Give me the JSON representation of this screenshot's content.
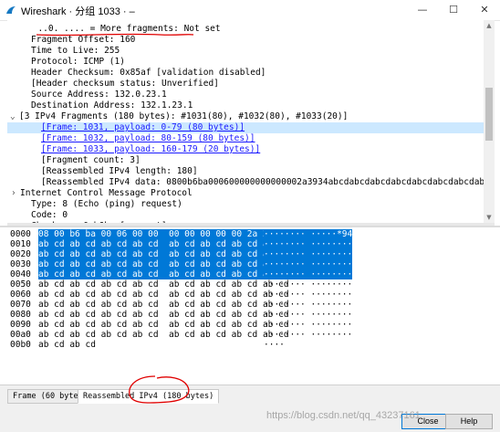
{
  "window": {
    "title": "Wireshark · 分组 1033 · –",
    "minimize": "—",
    "maximize": "☐",
    "close": "✕",
    "accent": "#0078d7",
    "selection_color": "#cce8ff"
  },
  "detail_rows": [
    {
      "text": "  ..0. .... = More fragments: Not set",
      "indent": 22,
      "toggle": "",
      "link": false,
      "selected": false
    },
    {
      "text": "Fragment Offset: 160",
      "indent": 26,
      "toggle": "",
      "link": false,
      "selected": false
    },
    {
      "text": "Time to Live: 255",
      "indent": 26,
      "toggle": "",
      "link": false,
      "selected": false
    },
    {
      "text": "Protocol: ICMP (1)",
      "indent": 26,
      "toggle": "",
      "link": false,
      "selected": false
    },
    {
      "text": "Header Checksum: 0x85af [validation disabled]",
      "indent": 26,
      "toggle": "",
      "link": false,
      "selected": false
    },
    {
      "text": "[Header checksum status: Unverified]",
      "indent": 26,
      "toggle": "",
      "link": false,
      "selected": false
    },
    {
      "text": "Source Address: 132.0.23.1",
      "indent": 26,
      "toggle": "",
      "link": false,
      "selected": false
    },
    {
      "text": "Destination Address: 132.1.23.1",
      "indent": 26,
      "toggle": "",
      "link": false,
      "selected": false
    },
    {
      "text": "[3 IPv4 Fragments (180 bytes): #1031(80), #1032(80), #1033(20)]",
      "indent": 15,
      "toggle": "⌄",
      "link": false,
      "selected": false
    },
    {
      "text": "[Frame: 1031, payload: 0-79 (80 bytes)]",
      "indent": 37,
      "toggle": "",
      "link": true,
      "selected": true
    },
    {
      "text": "[Frame: 1032, payload: 80-159 (80 bytes)]",
      "indent": 37,
      "toggle": "",
      "link": true,
      "selected": false
    },
    {
      "text": "[Frame: 1033, payload: 160-179 (20 bytes)]",
      "indent": 37,
      "toggle": "",
      "link": true,
      "selected": false
    },
    {
      "text": "[Fragment count: 3]",
      "indent": 37,
      "toggle": "",
      "link": false,
      "selected": false
    },
    {
      "text": "[Reassembled IPv4 length: 180]",
      "indent": 37,
      "toggle": "",
      "link": false,
      "selected": false
    },
    {
      "text": "[Reassembled IPv4 data: 0800b6ba000600000000000002a3934abcdabcdabcdabcdabcdabcdabcdabcdabcd…]",
      "indent": 37,
      "toggle": "",
      "link": false,
      "selected": false
    },
    {
      "text": "Internet Control Message Protocol",
      "indent": 4,
      "toggle": "›",
      "link": false,
      "selected": false
    },
    {
      "text": "Type: 8 (Echo (ping) request)",
      "indent": 26,
      "toggle": "",
      "link": false,
      "selected": false
    },
    {
      "text": "Code: 0",
      "indent": 26,
      "toggle": "",
      "link": false,
      "selected": false
    },
    {
      "text": "Checksum: 0xb6ba [correct]",
      "indent": 26,
      "toggle": "",
      "link": false,
      "selected": false
    }
  ],
  "byte_rows": [
    {
      "offset": "0000",
      "hex": "08 00 b6 ba 00 06 00 00  00 00 00 00 00 2a 39 34",
      "ascii": "········ ·····*94",
      "highlight": true
    },
    {
      "offset": "0010",
      "hex": "ab cd ab cd ab cd ab cd  ab cd ab cd ab cd ab cd",
      "ascii": "········ ········",
      "highlight": true
    },
    {
      "offset": "0020",
      "hex": "ab cd ab cd ab cd ab cd  ab cd ab cd ab cd ab cd",
      "ascii": "········ ········",
      "highlight": true
    },
    {
      "offset": "0030",
      "hex": "ab cd ab cd ab cd ab cd  ab cd ab cd ab cd ab cd",
      "ascii": "········ ········",
      "highlight": true
    },
    {
      "offset": "0040",
      "hex": "ab cd ab cd ab cd ab cd  ab cd ab cd ab cd ab cd",
      "ascii": "········ ········",
      "highlight": true
    },
    {
      "offset": "0050",
      "hex": "ab cd ab cd ab cd ab cd  ab cd ab cd ab cd ab cd",
      "ascii": "········ ········",
      "highlight": false
    },
    {
      "offset": "0060",
      "hex": "ab cd ab cd ab cd ab cd  ab cd ab cd ab cd ab cd",
      "ascii": "········ ········",
      "highlight": false
    },
    {
      "offset": "0070",
      "hex": "ab cd ab cd ab cd ab cd  ab cd ab cd ab cd ab cd",
      "ascii": "········ ········",
      "highlight": false
    },
    {
      "offset": "0080",
      "hex": "ab cd ab cd ab cd ab cd  ab cd ab cd ab cd ab cd",
      "ascii": "········ ········",
      "highlight": false
    },
    {
      "offset": "0090",
      "hex": "ab cd ab cd ab cd ab cd  ab cd ab cd ab cd ab cd",
      "ascii": "········ ········",
      "highlight": false
    },
    {
      "offset": "00a0",
      "hex": "ab cd ab cd ab cd ab cd  ab cd ab cd ab cd ab cd",
      "ascii": "········ ········",
      "highlight": false
    },
    {
      "offset": "00b0",
      "hex": "ab cd ab cd",
      "ascii": "····",
      "highlight": false
    }
  ],
  "tabs": [
    {
      "label": "Frame (60 bytes)",
      "active": false
    },
    {
      "label": "Reassembled IPv4 (180 bytes)",
      "active": true
    }
  ],
  "buttons": {
    "close": "Close",
    "help": "Help"
  },
  "watermark": "https://blog.csdn.net/qq_43237161"
}
